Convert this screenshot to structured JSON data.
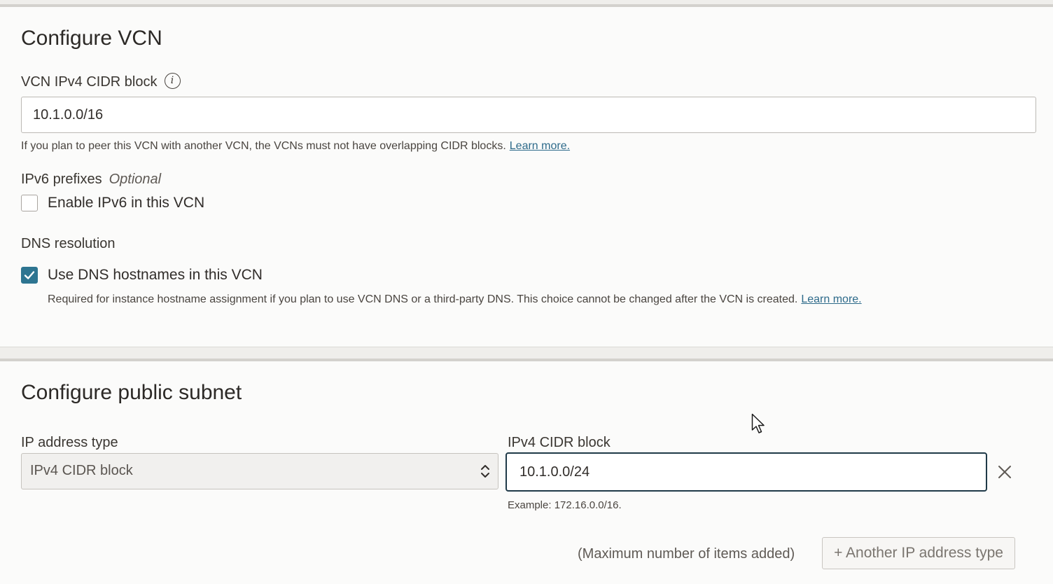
{
  "vcn": {
    "title": "Configure VCN",
    "cidr_label": "VCN IPv4 CIDR block",
    "cidr_info_icon": "info-icon",
    "cidr_value": "10.1.0.0/16",
    "cidr_help": "If you plan to peer this VCN with another VCN, the VCNs must not have overlapping CIDR blocks.",
    "cidr_help_link": "Learn more.",
    "ipv6_label": "IPv6 prefixes",
    "ipv6_optional": "Optional",
    "ipv6_checkbox_label": "Enable IPv6 in this VCN",
    "ipv6_checked": false,
    "dns_label": "DNS resolution",
    "dns_checkbox_label": "Use DNS hostnames in this VCN",
    "dns_checked": true,
    "dns_help": "Required for instance hostname assignment if you plan to use VCN DNS or a third-party DNS. This choice cannot be changed after the VCN is created.",
    "dns_help_link": "Learn more."
  },
  "subnet": {
    "title": "Configure public subnet",
    "ip_type_label": "IP address type",
    "ip_type_value": "IPv4 CIDR block",
    "cidr_label": "IPv4 CIDR block",
    "cidr_value": "10.1.0.0/24",
    "cidr_example": "Example: 172.16.0.0/16.",
    "max_items_note": "(Maximum number of items added)",
    "another_button": "+ Another IP address type"
  },
  "colors": {
    "accent": "#2e7591",
    "link": "#2d6a8a",
    "focus_border": "#1f3a48"
  }
}
